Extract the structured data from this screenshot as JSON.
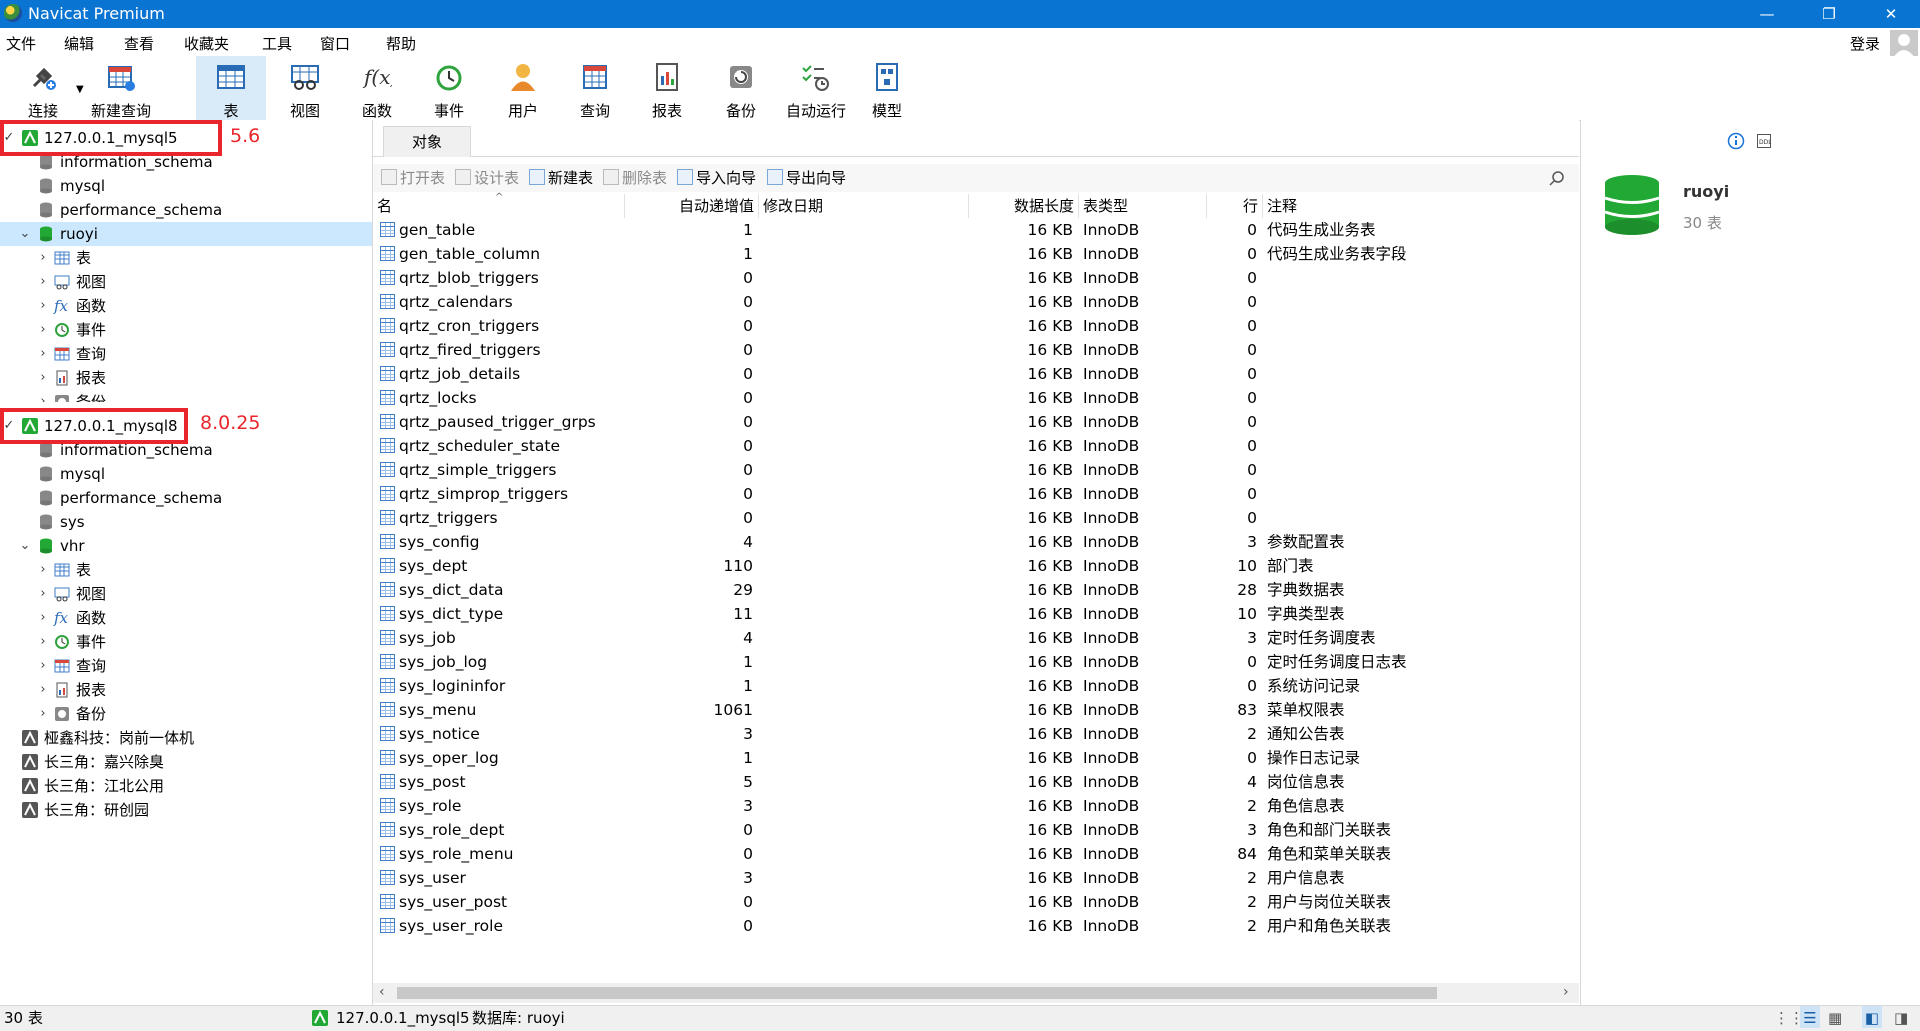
{
  "window": {
    "title": "Navicat Premium",
    "minimize": "—",
    "restore": "❐",
    "close": "✕"
  },
  "menu": [
    "文件",
    "编辑",
    "查看",
    "收藏夹",
    "工具",
    "窗口",
    "帮助"
  ],
  "login": "登录",
  "toolbar": [
    {
      "label": "连接",
      "icon": "plug-icon"
    },
    {
      "label": "新建查询",
      "icon": "new-query-icon"
    },
    {
      "label": "表",
      "icon": "table-icon",
      "active": true
    },
    {
      "label": "视图",
      "icon": "view-icon"
    },
    {
      "label": "函数",
      "icon": "function-icon"
    },
    {
      "label": "事件",
      "icon": "event-clock-icon"
    },
    {
      "label": "用户",
      "icon": "user-icon"
    },
    {
      "label": "查询",
      "icon": "query-icon"
    },
    {
      "label": "报表",
      "icon": "report-icon"
    },
    {
      "label": "备份",
      "icon": "backup-icon"
    },
    {
      "label": "自动运行",
      "icon": "automation-icon"
    },
    {
      "label": "模型",
      "icon": "model-icon"
    }
  ],
  "tree": {
    "conn1": "127.0.0.1_mysql5",
    "conn1_dbs": [
      "information_schema",
      "mysql",
      "performance_schema"
    ],
    "ruoyi": "ruoyi",
    "ruoyi_children": [
      "表",
      "视图",
      "函数",
      "事件",
      "查询",
      "报表",
      "备份"
    ],
    "conn2": "127.0.0.1_mysql8",
    "conn2_dbs": [
      "information_schema",
      "mysql",
      "performance_schema",
      "sys"
    ],
    "vhr": "vhr",
    "vhr_children": [
      "表",
      "视图",
      "函数",
      "事件",
      "查询",
      "报表",
      "备份"
    ],
    "other_conns": [
      "桠鑫科技：岗前一体机",
      "长三角：嘉兴除臭",
      "长三角：江北公用",
      "长三角：研创园"
    ]
  },
  "annotations": {
    "mysql5_version": "5.6",
    "mysql8_version": "8.0.25"
  },
  "objects_tab": "对象",
  "subtoolbar": [
    {
      "label": "打开表",
      "enabled": false
    },
    {
      "label": "设计表",
      "enabled": false
    },
    {
      "label": "新建表",
      "enabled": true
    },
    {
      "label": "删除表",
      "enabled": false
    },
    {
      "label": "导入向导",
      "enabled": true
    },
    {
      "label": "导出向导",
      "enabled": true
    }
  ],
  "columns": [
    "名",
    "自动递增值",
    "修改日期",
    "数据长度",
    "表类型",
    "行",
    "注释"
  ],
  "rows": [
    [
      "gen_table",
      "1",
      "",
      "16 KB",
      "InnoDB",
      "0",
      "代码生成业务表"
    ],
    [
      "gen_table_column",
      "1",
      "",
      "16 KB",
      "InnoDB",
      "0",
      "代码生成业务表字段"
    ],
    [
      "qrtz_blob_triggers",
      "0",
      "",
      "16 KB",
      "InnoDB",
      "0",
      ""
    ],
    [
      "qrtz_calendars",
      "0",
      "",
      "16 KB",
      "InnoDB",
      "0",
      ""
    ],
    [
      "qrtz_cron_triggers",
      "0",
      "",
      "16 KB",
      "InnoDB",
      "0",
      ""
    ],
    [
      "qrtz_fired_triggers",
      "0",
      "",
      "16 KB",
      "InnoDB",
      "0",
      ""
    ],
    [
      "qrtz_job_details",
      "0",
      "",
      "16 KB",
      "InnoDB",
      "0",
      ""
    ],
    [
      "qrtz_locks",
      "0",
      "",
      "16 KB",
      "InnoDB",
      "0",
      ""
    ],
    [
      "qrtz_paused_trigger_grps",
      "0",
      "",
      "16 KB",
      "InnoDB",
      "0",
      ""
    ],
    [
      "qrtz_scheduler_state",
      "0",
      "",
      "16 KB",
      "InnoDB",
      "0",
      ""
    ],
    [
      "qrtz_simple_triggers",
      "0",
      "",
      "16 KB",
      "InnoDB",
      "0",
      ""
    ],
    [
      "qrtz_simprop_triggers",
      "0",
      "",
      "16 KB",
      "InnoDB",
      "0",
      ""
    ],
    [
      "qrtz_triggers",
      "0",
      "",
      "16 KB",
      "InnoDB",
      "0",
      ""
    ],
    [
      "sys_config",
      "4",
      "",
      "16 KB",
      "InnoDB",
      "3",
      "参数配置表"
    ],
    [
      "sys_dept",
      "110",
      "",
      "16 KB",
      "InnoDB",
      "10",
      "部门表"
    ],
    [
      "sys_dict_data",
      "29",
      "",
      "16 KB",
      "InnoDB",
      "28",
      "字典数据表"
    ],
    [
      "sys_dict_type",
      "11",
      "",
      "16 KB",
      "InnoDB",
      "10",
      "字典类型表"
    ],
    [
      "sys_job",
      "4",
      "",
      "16 KB",
      "InnoDB",
      "3",
      "定时任务调度表"
    ],
    [
      "sys_job_log",
      "1",
      "",
      "16 KB",
      "InnoDB",
      "0",
      "定时任务调度日志表"
    ],
    [
      "sys_logininfor",
      "1",
      "",
      "16 KB",
      "InnoDB",
      "0",
      "系统访问记录"
    ],
    [
      "sys_menu",
      "1061",
      "",
      "16 KB",
      "InnoDB",
      "83",
      "菜单权限表"
    ],
    [
      "sys_notice",
      "3",
      "",
      "16 KB",
      "InnoDB",
      "2",
      "通知公告表"
    ],
    [
      "sys_oper_log",
      "1",
      "",
      "16 KB",
      "InnoDB",
      "0",
      "操作日志记录"
    ],
    [
      "sys_post",
      "5",
      "",
      "16 KB",
      "InnoDB",
      "4",
      "岗位信息表"
    ],
    [
      "sys_role",
      "3",
      "",
      "16 KB",
      "InnoDB",
      "2",
      "角色信息表"
    ],
    [
      "sys_role_dept",
      "0",
      "",
      "16 KB",
      "InnoDB",
      "3",
      "角色和部门关联表"
    ],
    [
      "sys_role_menu",
      "0",
      "",
      "16 KB",
      "InnoDB",
      "84",
      "角色和菜单关联表"
    ],
    [
      "sys_user",
      "3",
      "",
      "16 KB",
      "InnoDB",
      "2",
      "用户信息表"
    ],
    [
      "sys_user_post",
      "0",
      "",
      "16 KB",
      "InnoDB",
      "2",
      "用户与岗位关联表"
    ],
    [
      "sys_user_role",
      "0",
      "",
      "16 KB",
      "InnoDB",
      "2",
      "用户和角色关联表"
    ]
  ],
  "info": {
    "name": "ruoyi",
    "count": "30 表"
  },
  "status": {
    "count": "30 表",
    "connection": "127.0.0.1_mysql5",
    "database": "数据库: ruoyi"
  },
  "colors": {
    "titlebar": "#0a74d2",
    "selection": "#cce8ff",
    "annotation": "#e8262b",
    "db_green": "#22a935"
  }
}
